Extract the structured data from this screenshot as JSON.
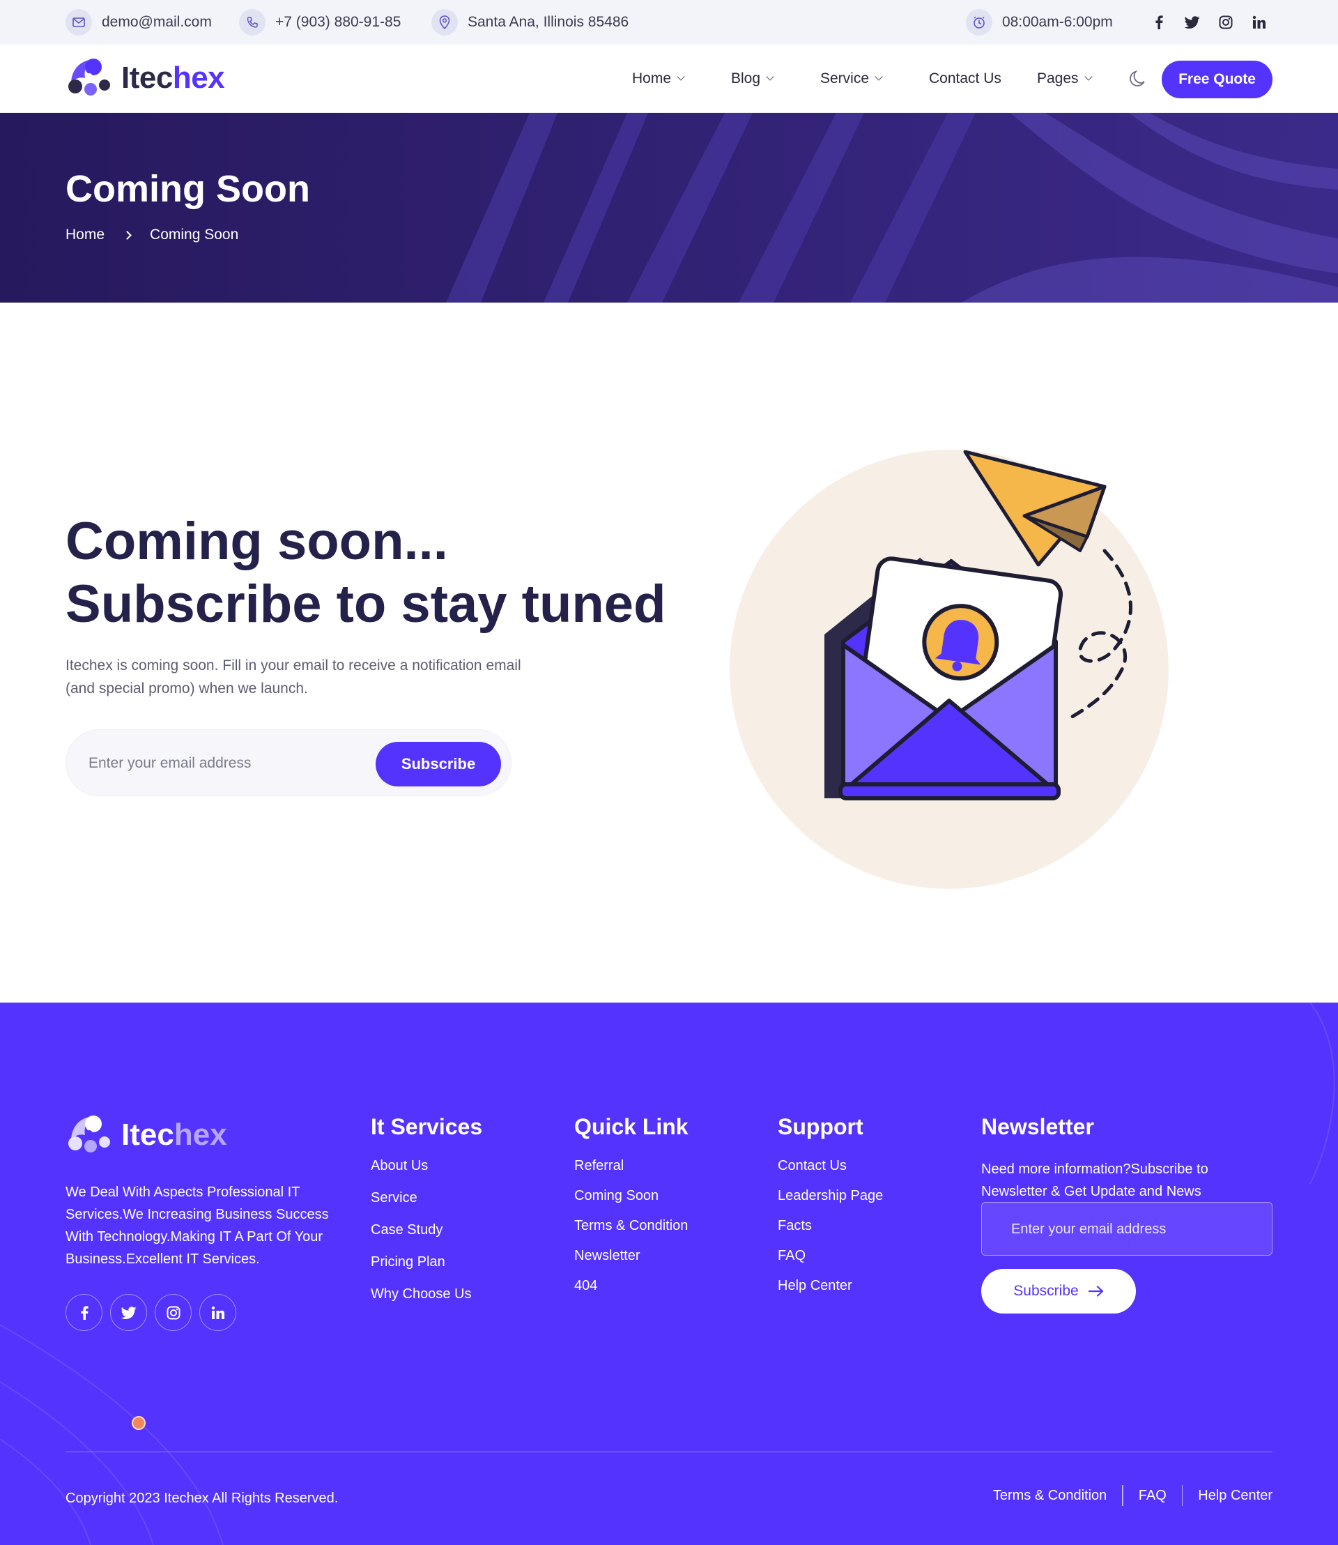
{
  "topbar": {
    "email": "demo@mail.com",
    "phone": "+7 (903) 880-91-85",
    "address": "Santa Ana, Illinois 85486",
    "hours": "08:00am-6:00pm",
    "socials": [
      "facebook-icon",
      "twitter-icon",
      "instagram-icon",
      "linkedin-icon"
    ]
  },
  "brand": {
    "name_part1": "Itec",
    "name_part2": "hex",
    "accent_color": "#5533ff"
  },
  "nav": {
    "items": [
      {
        "label": "Home",
        "has_dropdown": true
      },
      {
        "label": "Blog",
        "has_dropdown": true
      },
      {
        "label": "Service",
        "has_dropdown": true
      },
      {
        "label": "Contact Us",
        "has_dropdown": false
      },
      {
        "label": "Pages",
        "has_dropdown": true
      }
    ],
    "cta_label": "Free Quote"
  },
  "banner": {
    "title": "Coming Soon",
    "breadcrumb": [
      "Home",
      "Coming Soon"
    ],
    "background_color": "#27195d"
  },
  "main": {
    "title_line1": "Coming soon...",
    "title_line2": "Subscribe to stay tuned",
    "description": "Itechex is coming soon. Fill in your email to receive a notification email (and special promo) when we launch.",
    "email_placeholder": "Enter your email address",
    "subscribe_label": "Subscribe"
  },
  "footer": {
    "about": "We Deal With Aspects Professional IT Services.We Increasing Business Success With Technology.Making IT A Part Of Your Business.Excellent IT Services.",
    "columns": [
      {
        "title": "It Services",
        "links": [
          "About Us",
          "Service",
          "Case Study",
          "Pricing Plan",
          "Why Choose Us"
        ]
      },
      {
        "title": "Quick Link",
        "links": [
          "Referral",
          "Coming Soon",
          "Terms & Condition",
          "Newsletter",
          "404"
        ]
      },
      {
        "title": "Support",
        "links": [
          "Contact Us",
          "Leadership Page",
          "Facts",
          "FAQ",
          "Help Center"
        ]
      }
    ],
    "newsletter": {
      "title": "Newsletter",
      "description": "Need more information?Subscribe to Newsletter & Get Update and News",
      "placeholder": "Enter your email address",
      "button_label": "Subscribe"
    },
    "copyright": "Copyright 2023 Itechex All Rights Reserved.",
    "bottom_links": [
      "Terms & Condition",
      "FAQ",
      "Help Center"
    ],
    "background_color": "#5533ff"
  }
}
